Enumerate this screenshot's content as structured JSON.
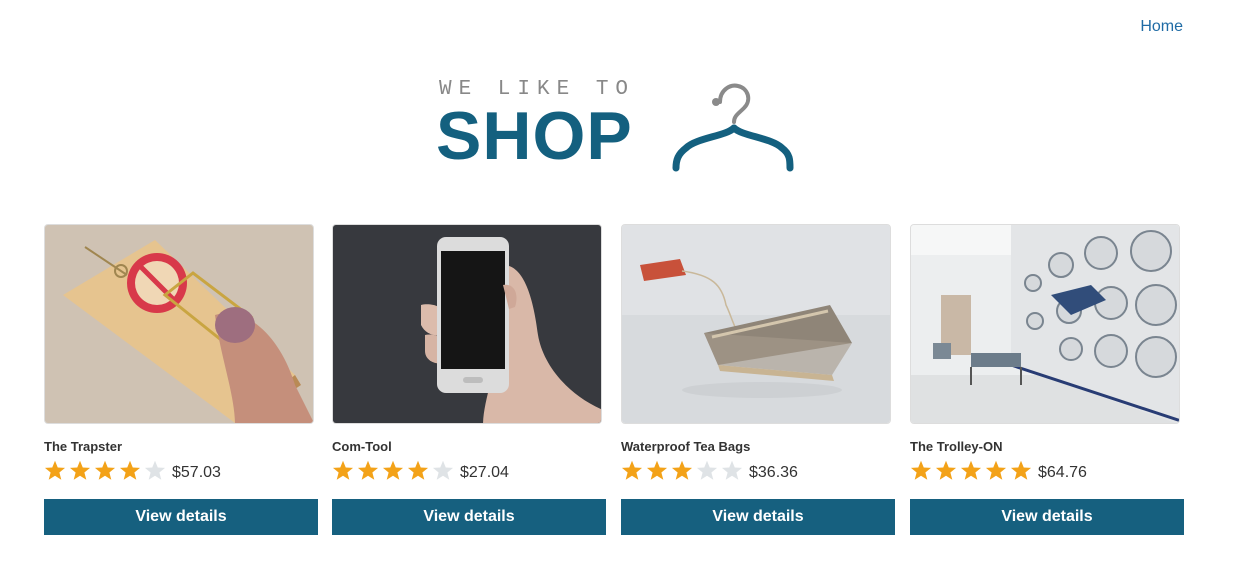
{
  "nav": {
    "home_label": "Home"
  },
  "logo": {
    "tagline": "WE LIKE TO",
    "word": "SHOP"
  },
  "colors": {
    "brand": "#14607f",
    "button": "#16607f",
    "link": "#1f6ba5",
    "star_filled": "#f3a218",
    "star_empty": "#dfe3e6"
  },
  "products": [
    {
      "title": "The Trapster",
      "rating": 4,
      "max_rating": 5,
      "price": "$57.03",
      "button_label": "View details",
      "image": "mousetrap-photo"
    },
    {
      "title": "Com-Tool",
      "rating": 4,
      "max_rating": 5,
      "price": "$27.04",
      "button_label": "View details",
      "image": "smartphone-in-hand-photo"
    },
    {
      "title": "Waterproof Tea Bags",
      "rating": 3,
      "max_rating": 5,
      "price": "$36.36",
      "button_label": "View details",
      "image": "tea-bag-photo"
    },
    {
      "title": "The Trolley-ON",
      "rating": 5,
      "max_rating": 5,
      "price": "$64.76",
      "button_label": "View details",
      "image": "laundromat-photo"
    }
  ]
}
